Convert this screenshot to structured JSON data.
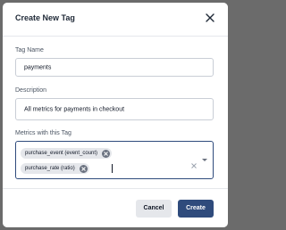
{
  "dialog": {
    "title": "Create New Tag",
    "close_icon": "close-icon"
  },
  "form": {
    "tag_name": {
      "label": "Tag Name",
      "value": "payments"
    },
    "description": {
      "label": "Description",
      "value": "All metrics for payments in checkout"
    },
    "metrics": {
      "label": "Metrics with this Tag",
      "selected": [
        "purchase_event (event_count)",
        "purchase_rate (ratio)"
      ],
      "clear_icon": "clear-icon",
      "dropdown_icon": "chevron-down-icon",
      "chip_remove_icon": "remove-chip-icon"
    }
  },
  "footer": {
    "cancel_label": "Cancel",
    "create_label": "Create"
  },
  "colors": {
    "primary": "#2f4b7c",
    "overlay": "#6b6b6b",
    "chip_bg": "#e5e7eb"
  }
}
